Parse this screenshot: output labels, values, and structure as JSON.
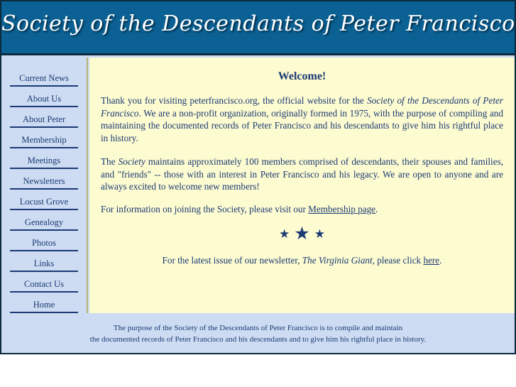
{
  "banner": {
    "title": "Society of the Descendants of Peter Francisco"
  },
  "colors": {
    "banner_blue": "#0b6193",
    "sidebar_blue": "#cddcf2",
    "content_yellow": "#fdfbd0",
    "text_navy": "#1b3a74",
    "frame_dark": "#0d2a3d",
    "divider_olive": "#b5b478"
  },
  "sidebar": {
    "items": [
      {
        "label": "Current News"
      },
      {
        "label": "About Us"
      },
      {
        "label": "About Peter"
      },
      {
        "label": "Membership"
      },
      {
        "label": "Meetings"
      },
      {
        "label": "Newsletters"
      },
      {
        "label": "Locust Grove"
      },
      {
        "label": "Genealogy"
      },
      {
        "label": "Photos"
      },
      {
        "label": "Links"
      },
      {
        "label": "Contact Us"
      },
      {
        "label": "Home"
      }
    ]
  },
  "main": {
    "heading": "Welcome!",
    "paragraph1": {
      "part1": "Thank you for visiting peterfrancisco.org, the official website for the ",
      "italic1": "Society of the Descendants of Peter Francisco",
      "part2": ". We are a non-profit organization, originally formed in 1975, with the purpose of compiling and maintaining the documented records of Peter Francisco and his descendants to give him his rightful place in history."
    },
    "paragraph2": {
      "part1": "The ",
      "italic1": "Society",
      "part2": " maintains approximately 100 members comprised of descendants, their spouses and families, and \"friends\" -- those with an interest in Peter Francisco and his legacy. We are open to anyone and are always excited to welcome new members!"
    },
    "paragraph3": {
      "part1": "For information on joining the Society, please visit our ",
      "link": "Membership page",
      "part2": "."
    },
    "stars": {
      "left": "★",
      "center": "★",
      "right": "★"
    },
    "newsletter": {
      "part1": "For the latest issue of our newsletter, ",
      "italic1": "The Virginia Giant",
      "part2": ", please click ",
      "link": "here",
      "part3": "."
    }
  },
  "footer": {
    "line1": "The purpose of the Society of the Descendants of Peter Francisco is to compile and maintain",
    "line2": "the documented records of Peter Francisco and his descendants and to give him his rightful place in history."
  }
}
